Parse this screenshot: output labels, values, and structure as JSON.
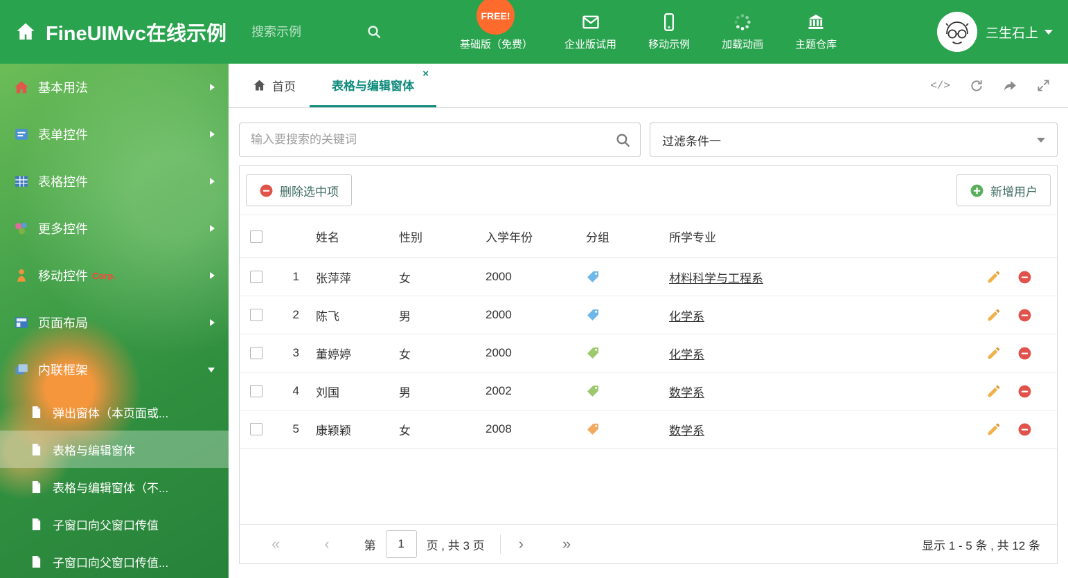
{
  "colors": {
    "header_green": "#2aa34f",
    "accent_teal": "#0e8a7c",
    "danger_red": "#e1524a",
    "success_green": "#58ae5a",
    "pencil_orange": "#f0b14a",
    "free_badge_orange": "#ff6b2c"
  },
  "header": {
    "title": "FineUIMvc在线示例",
    "search_placeholder": "搜索示例",
    "free_badge": "FREE!",
    "nav": [
      {
        "label": "基础版（免费）",
        "icon": "download-icon"
      },
      {
        "label": "企业版试用",
        "icon": "envelope-icon"
      },
      {
        "label": "移动示例",
        "icon": "mobile-icon"
      },
      {
        "label": "加载动画",
        "icon": "spinner-icon"
      },
      {
        "label": "主题仓库",
        "icon": "bank-icon"
      }
    ],
    "user_name": "三生石上"
  },
  "sidebar": {
    "items": [
      {
        "label": "基本用法"
      },
      {
        "label": "表单控件"
      },
      {
        "label": "表格控件"
      },
      {
        "label": "更多控件"
      },
      {
        "label": "移动控件",
        "badge": "Corp."
      },
      {
        "label": "页面布局"
      },
      {
        "label": "内联框架"
      }
    ],
    "subitems": [
      {
        "label": "弹出窗体（本页面或..."
      },
      {
        "label": "表格与编辑窗体"
      },
      {
        "label": "表格与编辑窗体（不..."
      },
      {
        "label": "子窗口向父窗口传值"
      },
      {
        "label": "子窗口向父窗口传值..."
      }
    ]
  },
  "tabs": {
    "home": "首页",
    "active": "表格与编辑窗体",
    "close": "×"
  },
  "filter": {
    "search_placeholder": "输入要搜索的关键词",
    "dropdown_value": "过滤条件一"
  },
  "grid": {
    "delete_button": "删除选中项",
    "add_button": "新增用户",
    "columns": [
      "姓名",
      "性别",
      "入学年份",
      "分组",
      "所学专业"
    ],
    "rows": [
      {
        "num": "1",
        "name": "张萍萍",
        "gender": "女",
        "year": "2000",
        "tag_color": "#6fb7e9",
        "major": "材料科学与工程系"
      },
      {
        "num": "2",
        "name": "陈飞",
        "gender": "男",
        "year": "2000",
        "tag_color": "#6fb7e9",
        "major": "化学系"
      },
      {
        "num": "3",
        "name": "董婷婷",
        "gender": "女",
        "year": "2000",
        "tag_color": "#9dc86d",
        "major": "化学系"
      },
      {
        "num": "4",
        "name": "刘国",
        "gender": "男",
        "year": "2002",
        "tag_color": "#9dc86d",
        "major": "数学系"
      },
      {
        "num": "5",
        "name": "康颖颖",
        "gender": "女",
        "year": "2008",
        "tag_color": "#f2a95f",
        "major": "数学系"
      }
    ],
    "pager": {
      "prefix": "第",
      "page": "1",
      "suffix": "页 , 共 3 页",
      "summary": "显示 1 - 5 条 , 共 12 条"
    }
  }
}
